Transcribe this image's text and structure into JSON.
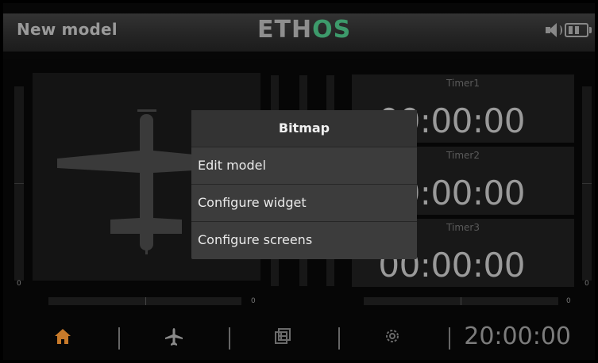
{
  "header": {
    "model_name": "New model",
    "logo_part1": "ETH",
    "logo_part2": "OS",
    "icons": [
      "speaker-icon",
      "battery-icon"
    ]
  },
  "widgets": {
    "left_gauge_value": "0",
    "left_hbar_value": "0",
    "right_gauge_value": "0",
    "right_hbar_value": "0",
    "bitmap_icon": "airplane-icon"
  },
  "timers": [
    {
      "label": "Timer1",
      "value": "00:00:00"
    },
    {
      "label": "Timer2",
      "value": "00:00:00"
    },
    {
      "label": "Timer3",
      "value": "00:00:00"
    }
  ],
  "menu": {
    "title": "Bitmap",
    "items": [
      "Edit model",
      "Configure widget",
      "Configure screens"
    ]
  },
  "bottom_nav": {
    "icons": [
      "home-icon",
      "airplane-icon",
      "screens-icon",
      "gear-icon"
    ],
    "clock": "20:00:00"
  },
  "colors": {
    "accent_os": "#3d9a6b",
    "home_active": "#c87a2a",
    "menu_bg": "#3c3c3c"
  }
}
